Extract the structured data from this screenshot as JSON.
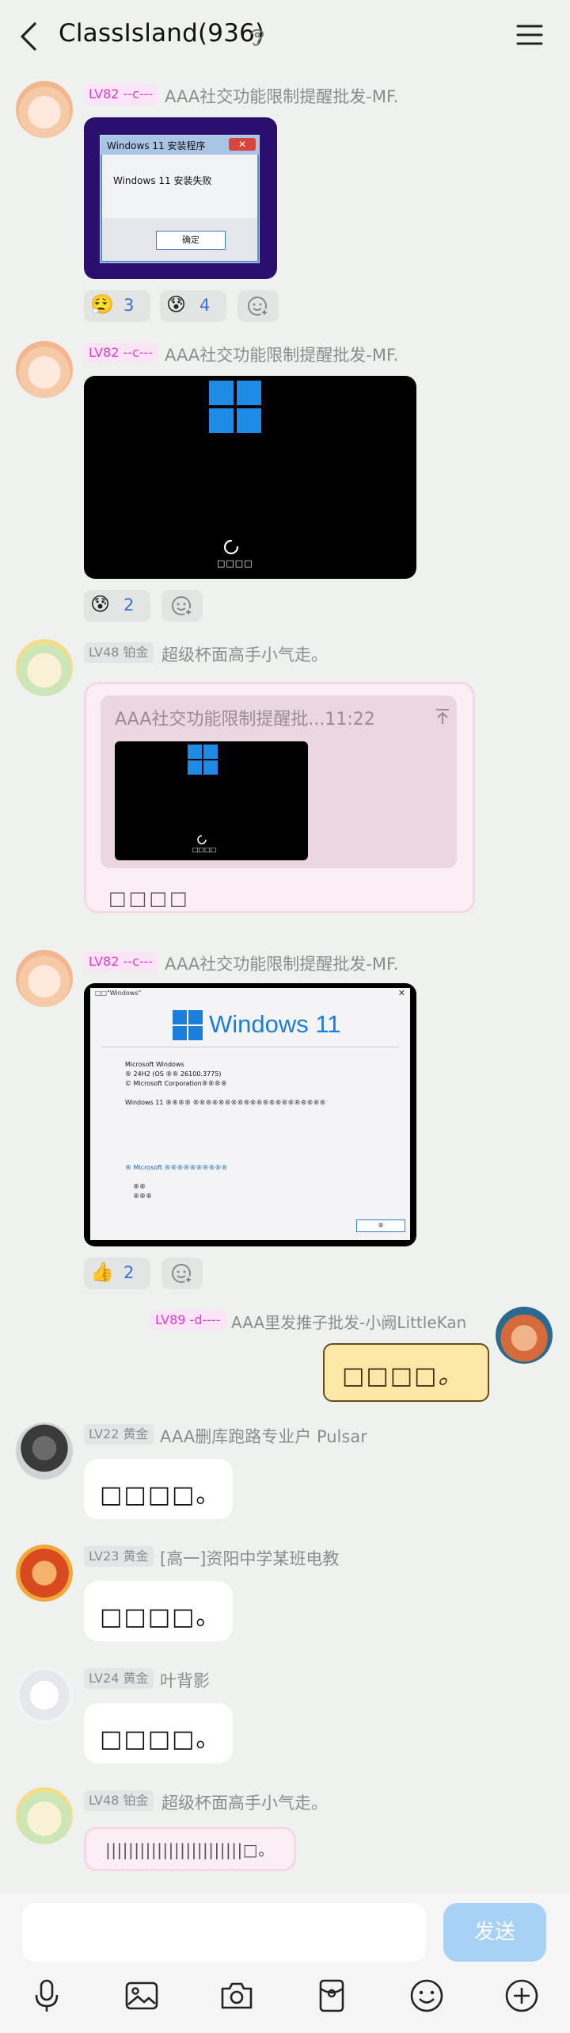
{
  "header": {
    "title": "ClassIsland(936)",
    "back_icon": "back-arrow-icon",
    "ear_icon": "ear-icon",
    "menu_icon": "hamburger-menu-icon"
  },
  "messages": [
    {
      "avatar": "avatar-blonde",
      "badge": "LV82 --c---",
      "sender": "AAA社交功能限制提醒批发-MF.",
      "image": {
        "window_title": "Windows 11 安装程序",
        "message": "Windows 11 安装失败",
        "button": "确定"
      },
      "reactions": [
        {
          "emoji": "😮‍💨",
          "count": "3"
        },
        {
          "emoji": "😰",
          "count": "4"
        }
      ]
    },
    {
      "avatar": "avatar-blonde",
      "badge": "LV82 --c---",
      "sender": "AAA社交功能限制提醒批发-MF.",
      "image": {
        "loading_text": "□□□□"
      },
      "reactions": [
        {
          "emoji": "😰",
          "count": "2"
        }
      ]
    },
    {
      "avatar": "avatar-green",
      "badge": "LV48 铂金",
      "sender": "超级杯面高手小气走。",
      "reply": {
        "quote_header": "AAA社交功能限制提醒批...11:22",
        "image_text": "□□□□",
        "text": "□□□□"
      }
    },
    {
      "avatar": "avatar-blonde",
      "badge": "LV82 --c---",
      "sender": "AAA社交功能限制提醒批发-MF.",
      "image": {
        "window_caption": "□□\"Windows\"",
        "logo_text": "Windows 11",
        "line1": "Microsoft Windows",
        "line2": "® 24H2 (OS ®® 26100.3775)",
        "line3": "© Microsoft Corporation®®®®",
        "line4": "Windows 11 ®®®® ®®®®®®®®®®®®®®®®®®®®®",
        "line5": "® Microsoft ®®®®®®®®®®",
        "line6": "®®",
        "line7": "®®®",
        "ok_button": "®"
      },
      "reactions": [
        {
          "emoji": "👍",
          "count": "2"
        }
      ]
    },
    {
      "avatar": "avatar-fox",
      "badge": "LV89 -d----",
      "sender": "AAA里发推子批发-小阙LittleKan",
      "text": "□□□□。"
    },
    {
      "avatar": "avatar-mask",
      "badge": "LV22 黄金",
      "sender": "AAA删库跑路专业户 Pulsar",
      "text": "□□□□。"
    },
    {
      "avatar": "avatar-red",
      "badge": "LV23 黄金",
      "sender": "[高一]资阳中学某班电教",
      "text": "□□□□。"
    },
    {
      "avatar": "avatar-white",
      "badge": "LV24 黄金",
      "sender": "叶背影",
      "text": "□□□□。"
    },
    {
      "avatar": "avatar-green",
      "badge": "LV48 铂金",
      "sender": "超级杯面高手小气走。",
      "text": "||||||||||||||||||||||||□。"
    }
  ],
  "composer": {
    "send_label": "发送",
    "tools": [
      "microphone-icon",
      "image-icon",
      "camera-icon",
      "red-packet-icon",
      "emoji-icon",
      "plus-icon"
    ]
  }
}
